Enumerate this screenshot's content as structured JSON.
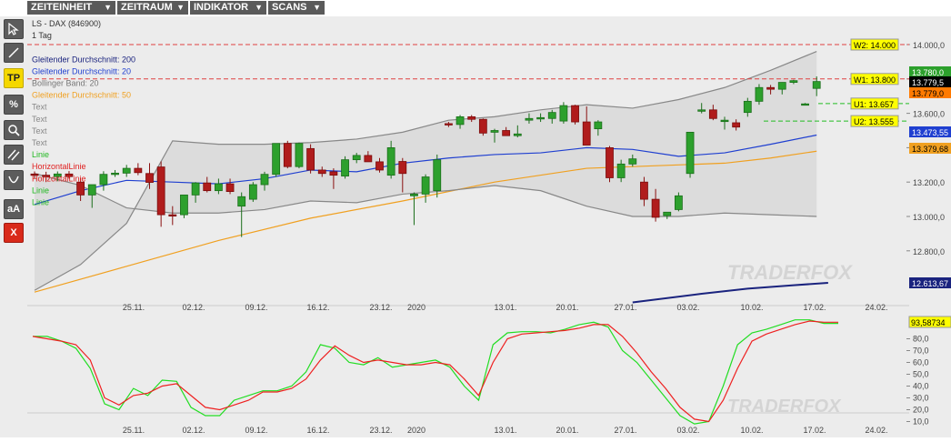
{
  "menu": [
    {
      "label": "ZEITEINHEIT"
    },
    {
      "label": "ZEITRAUM"
    },
    {
      "label": "INDIKATOR"
    },
    {
      "label": "SCANS"
    }
  ],
  "tools": [
    {
      "name": "cursor-tool-icon"
    },
    {
      "name": "line-tool-icon"
    },
    {
      "name": "tp-tool",
      "label": "TP"
    },
    {
      "name": "percent-tool-icon",
      "label": "%"
    },
    {
      "name": "search-tool-icon"
    },
    {
      "name": "parallel-lines-tool-icon"
    },
    {
      "name": "curve-tool-icon"
    },
    {
      "name": "text-tool",
      "label": "aA"
    },
    {
      "name": "delete-tool-icon",
      "label": "X"
    }
  ],
  "legend": [
    {
      "text": "LS - DAX (846900)",
      "color": "#333333"
    },
    {
      "text": "1 Tag",
      "color": "#333333"
    },
    {
      "text": "",
      "color": "#333333"
    },
    {
      "text": "Gleitender Durchschnitt: 200",
      "color": "#1a237e"
    },
    {
      "text": "Gleitender Durchschnitt: 20",
      "color": "#1f3fd0"
    },
    {
      "text": "Bollinger Band: 20",
      "color": "#777777"
    },
    {
      "text": "Gleitender Durchschnitt: 50",
      "color": "#f0a020"
    },
    {
      "text": "Text",
      "color": "#888888"
    },
    {
      "text": "Text",
      "color": "#888888"
    },
    {
      "text": "Text",
      "color": "#888888"
    },
    {
      "text": "Text",
      "color": "#888888"
    },
    {
      "text": "Linie",
      "color": "#22b822"
    },
    {
      "text": "HorizontalLinie",
      "color": "#e02020"
    },
    {
      "text": "HorizontalLinie",
      "color": "#e02020"
    },
    {
      "text": "Linie",
      "color": "#22b822"
    },
    {
      "text": "Linie",
      "color": "#22b822"
    }
  ],
  "watermark": "TRADERFOX",
  "chart_data": [
    {
      "type": "candlestick",
      "title": "LS - DAX (846900)",
      "timeframe": "1 Tag",
      "ylim": [
        12450,
        14250
      ],
      "yticks": [
        "14.000,0",
        "13.800,0",
        "13.600,0",
        "13.400,0",
        "13.200,0",
        "13.000,0",
        "12.800,0"
      ],
      "ytick_values": [
        14000,
        13800,
        13600,
        13400,
        13200,
        13000,
        12800
      ],
      "xticks": [
        "25.11.",
        "02.12.",
        "09.12.",
        "16.12.",
        "23.12.",
        "2020",
        "13.01.",
        "20.01.",
        "27.01.",
        "03.02.",
        "10.02.",
        "17.02.",
        "24.02."
      ],
      "candles": [
        [
          13247,
          13262,
          13222,
          13240
        ],
        [
          13240,
          13260,
          13200,
          13232
        ],
        [
          13232,
          13262,
          13205,
          13247
        ],
        [
          13247,
          13264,
          13220,
          13232
        ],
        [
          13200,
          13225,
          13090,
          13125
        ],
        [
          13125,
          13160,
          13050,
          13185
        ],
        [
          13185,
          13263,
          13150,
          13245
        ],
        [
          13245,
          13270,
          13230,
          13252
        ],
        [
          13252,
          13300,
          13230,
          13280
        ],
        [
          13280,
          13310,
          13240,
          13255
        ],
        [
          13250,
          13310,
          13160,
          13198
        ],
        [
          13288,
          13320,
          12940,
          13010
        ],
        [
          13010,
          13060,
          12950,
          13005
        ],
        [
          13010,
          13125,
          12990,
          13125
        ],
        [
          13125,
          13200,
          13080,
          13195
        ],
        [
          13195,
          13230,
          13140,
          13150
        ],
        [
          13150,
          13220,
          13130,
          13190
        ],
        [
          13190,
          13220,
          13130,
          13145
        ],
        [
          13060,
          13140,
          12880,
          13115
        ],
        [
          13100,
          13200,
          13085,
          13185
        ],
        [
          13185,
          13260,
          13150,
          13245
        ],
        [
          13245,
          13420,
          13230,
          13425
        ],
        [
          13425,
          13440,
          13280,
          13290
        ],
        [
          13290,
          13430,
          13280,
          13425
        ],
        [
          13395,
          13420,
          13250,
          13270
        ],
        [
          13270,
          13290,
          13230,
          13250
        ],
        [
          13260,
          13280,
          13160,
          13240
        ],
        [
          13235,
          13350,
          13220,
          13330
        ],
        [
          13330,
          13370,
          13310,
          13355
        ],
        [
          13355,
          13380,
          13320,
          13318
        ],
        [
          13318,
          13340,
          13255,
          13270
        ],
        [
          13240,
          13440,
          13220,
          13400
        ],
        [
          13320,
          13340,
          13140,
          13250
        ],
        [
          13120,
          13140,
          12950,
          13130
        ],
        [
          13130,
          13245,
          13080,
          13230
        ],
        [
          13150,
          13360,
          13110,
          13330
        ],
        [
          13540,
          13550,
          13520,
          13535
        ],
        [
          13535,
          13590,
          13510,
          13580
        ],
        [
          13580,
          13590,
          13550,
          13565
        ],
        [
          13565,
          13570,
          13470,
          13485
        ],
        [
          13490,
          13510,
          13430,
          13500
        ],
        [
          13500,
          13520,
          13480,
          13470
        ],
        [
          13470,
          13530,
          13460,
          13480
        ],
        [
          13560,
          13600,
          13540,
          13570
        ],
        [
          13570,
          13600,
          13550,
          13575
        ],
        [
          13570,
          13620,
          13540,
          13605
        ],
        [
          13555,
          13665,
          13540,
          13645
        ],
        [
          13645,
          13650,
          13535,
          13550
        ],
        [
          13550,
          13640,
          13430,
          13415
        ],
        [
          13510,
          13560,
          13470,
          13550
        ],
        [
          13400,
          13410,
          13200,
          13225
        ],
        [
          13225,
          13330,
          13200,
          13305
        ],
        [
          13305,
          13360,
          13290,
          13335
        ],
        [
          13200,
          13230,
          13060,
          13100
        ],
        [
          13100,
          13160,
          12970,
          12995
        ],
        [
          13005,
          13020,
          12985,
          13025
        ],
        [
          13040,
          13140,
          13030,
          13120
        ],
        [
          13250,
          13380,
          13225,
          13490
        ],
        [
          13620,
          13660,
          13600,
          13620
        ],
        [
          13620,
          13650,
          13560,
          13570
        ],
        [
          13555,
          13580,
          13505,
          13560
        ],
        [
          13545,
          13565,
          13500,
          13520
        ],
        [
          13605,
          13690,
          13580,
          13670
        ],
        [
          13670,
          13770,
          13650,
          13750
        ],
        [
          13750,
          13765,
          13710,
          13740
        ],
        [
          13740,
          13780,
          13710,
          13780
        ],
        [
          13780,
          13795,
          13770,
          13790
        ],
        [
          13655,
          13660,
          13650,
          13655
        ],
        [
          13745,
          13815,
          13700,
          13785
        ]
      ],
      "levels": [
        {
          "label": "W2: 14.000",
          "value": 14000,
          "kind": "resistance"
        },
        {
          "label": "W1: 13.800",
          "value": 13800,
          "kind": "resistance"
        },
        {
          "label": "U1: 13.657",
          "value": 13657,
          "kind": "support"
        },
        {
          "label": "U2: 13.555",
          "value": 13555,
          "kind": "support"
        }
      ],
      "price_labels": [
        {
          "text": "13.780,0",
          "value": 13780,
          "color": "#2ca02c"
        },
        {
          "text": "13.779,5",
          "value": 13779.5,
          "color": "#000000"
        },
        {
          "text": "13.779,0",
          "value": 13779,
          "color": "#ff7a00"
        },
        {
          "text": "13.473,55",
          "value": 13473.55,
          "color": "#1f3fd0"
        },
        {
          "text": "13.379,68",
          "value": 13379.68,
          "color": "#f0a020"
        },
        {
          "text": "12.613,67",
          "value": 12613.67,
          "color": "#1a237e"
        }
      ],
      "series": [
        {
          "name": "Gleitender Durchschnitt: 200",
          "color": "#1a237e",
          "x": [
            52,
            58,
            62,
            66,
            69
          ],
          "values": [
            12500,
            12550,
            12580,
            12600,
            12613.67
          ]
        },
        {
          "name": "Gleitender Durchschnitt: 20",
          "color": "#1f3fd0",
          "x": [
            0,
            4,
            8,
            12,
            16,
            20,
            24,
            28,
            32,
            36,
            40,
            44,
            48,
            52,
            56,
            60,
            64,
            68
          ],
          "values": [
            13070,
            13150,
            13210,
            13200,
            13190,
            13220,
            13270,
            13260,
            13310,
            13340,
            13360,
            13370,
            13400,
            13390,
            13350,
            13370,
            13420,
            13473.55
          ]
        },
        {
          "name": "Gleitender Durchschnitt: 50",
          "color": "#f0a020",
          "x": [
            0,
            8,
            16,
            24,
            32,
            40,
            48,
            56,
            60,
            64,
            68
          ],
          "values": [
            12560,
            12710,
            12860,
            12990,
            13090,
            13200,
            13280,
            13300,
            13310,
            13340,
            13379.68
          ]
        },
        {
          "name": "Bollinger Band: 20",
          "part": "upper",
          "color": "#888888",
          "x": [
            0,
            4,
            8,
            12,
            16,
            20,
            24,
            28,
            32,
            36,
            40,
            44,
            48,
            52,
            56,
            60,
            64,
            68
          ],
          "values": [
            12570,
            12720,
            12960,
            13440,
            13420,
            13420,
            13430,
            13450,
            13490,
            13560,
            13580,
            13620,
            13650,
            13630,
            13680,
            13750,
            13850,
            13960
          ]
        },
        {
          "name": "Bollinger Band: 20",
          "part": "lower",
          "color": "#888888",
          "x": [
            0,
            4,
            8,
            12,
            16,
            20,
            24,
            28,
            32,
            36,
            40,
            44,
            48,
            52,
            56,
            60,
            64,
            68
          ],
          "values": [
            13250,
            13180,
            13050,
            13020,
            13020,
            13040,
            13090,
            13080,
            13130,
            13150,
            13180,
            13150,
            13060,
            13000,
            13000,
            13020,
            13010,
            13000
          ]
        }
      ]
    },
    {
      "type": "line",
      "ylim": [
        5,
        96
      ],
      "yticks": [
        "80,0",
        "70,0",
        "60,0",
        "50,0",
        "40,0",
        "30,0",
        "20,0",
        "10,0"
      ],
      "ytick_values": [
        80,
        70,
        60,
        50,
        40,
        30,
        20,
        10
      ],
      "last_value_label": "93,58734",
      "series": [
        {
          "name": "",
          "color": "#22dd22",
          "values": [
            82,
            82,
            78,
            72,
            55,
            25,
            20,
            38,
            32,
            45,
            44,
            22,
            15,
            15,
            28,
            32,
            36,
            36,
            40,
            52,
            75,
            72,
            60,
            58,
            64,
            56,
            58,
            60,
            62,
            56,
            40,
            28,
            75,
            85,
            86,
            86,
            85,
            88,
            92,
            94,
            90,
            70,
            60,
            45,
            30,
            15,
            8,
            10,
            40,
            75,
            85,
            88,
            92,
            96,
            96,
            93,
            93
          ]
        },
        {
          "name": "",
          "color": "#ee2020",
          "values": [
            82,
            80,
            78,
            75,
            62,
            30,
            24,
            32,
            34,
            40,
            42,
            32,
            22,
            20,
            24,
            28,
            35,
            35,
            38,
            46,
            62,
            74,
            66,
            60,
            62,
            60,
            58,
            58,
            60,
            58,
            46,
            32,
            60,
            80,
            84,
            85,
            86,
            87,
            89,
            92,
            92,
            82,
            68,
            52,
            38,
            22,
            12,
            10,
            28,
            55,
            78,
            84,
            88,
            92,
            95,
            94,
            94
          ]
        }
      ]
    }
  ]
}
